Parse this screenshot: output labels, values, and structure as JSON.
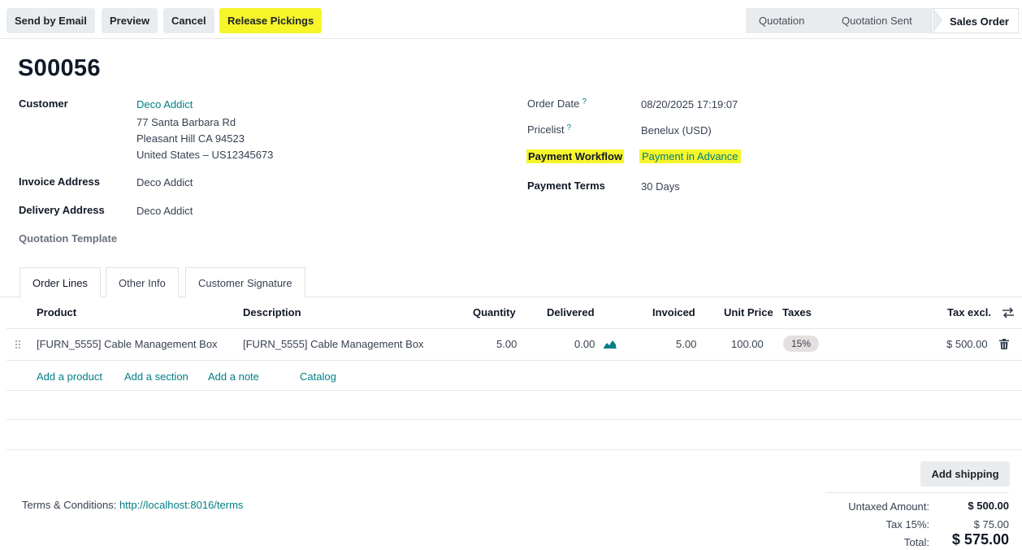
{
  "toolbar": {
    "send_email": "Send by Email",
    "preview": "Preview",
    "cancel": "Cancel",
    "release_pickings": "Release Pickings"
  },
  "statusbar": {
    "steps": [
      "Quotation",
      "Quotation Sent",
      "Sales Order"
    ],
    "active": "Sales Order"
  },
  "record": {
    "name": "S00056"
  },
  "left_fields": {
    "customer_label": "Customer",
    "customer_name": "Deco Addict",
    "address_line1": "77 Santa Barbara Rd",
    "address_line2": "Pleasant Hill CA 94523",
    "address_line3": "United States – US12345673",
    "invoice_label": "Invoice Address",
    "invoice_value": "Deco Addict",
    "delivery_label": "Delivery Address",
    "delivery_value": "Deco Addict",
    "template_label": "Quotation Template"
  },
  "right_fields": {
    "order_date_label": "Order Date",
    "order_date_value": "08/20/2025 17:19:07",
    "pricelist_label": "Pricelist",
    "pricelist_value": "Benelux (USD)",
    "workflow_label": "Payment Workflow",
    "workflow_value": "Payment in Advance",
    "terms_label": "Payment Terms",
    "terms_value": "30 Days",
    "help_mark": "?"
  },
  "tabs": [
    "Order Lines",
    "Other Info",
    "Customer Signature"
  ],
  "table": {
    "headers": {
      "product": "Product",
      "description": "Description",
      "quantity": "Quantity",
      "delivered": "Delivered",
      "invoiced": "Invoiced",
      "unit_price": "Unit Price",
      "taxes": "Taxes",
      "tax_excl": "Tax excl."
    },
    "rows": [
      {
        "product": "[FURN_5555] Cable Management Box",
        "description": "[FURN_5555] Cable Management Box",
        "quantity": "5.00",
        "delivered": "0.00",
        "invoiced": "5.00",
        "unit_price": "100.00",
        "tax": "15%",
        "subtotal": "$ 500.00"
      }
    ],
    "actions": [
      "Add a product",
      "Add a section",
      "Add a note",
      "Catalog"
    ]
  },
  "footer": {
    "add_shipping": "Add shipping",
    "terms_prefix": "Terms & Conditions:",
    "terms_link": "http://localhost:8016/terms",
    "untaxed_label": "Untaxed Amount:",
    "untaxed_value": "$ 500.00",
    "tax_label": "Tax 15%:",
    "tax_value": "$ 75.00",
    "total_label": "Total:",
    "total_value": "$ 575.00"
  },
  "colors": {
    "accent": "#017e84",
    "highlight": "#f5f52a"
  }
}
